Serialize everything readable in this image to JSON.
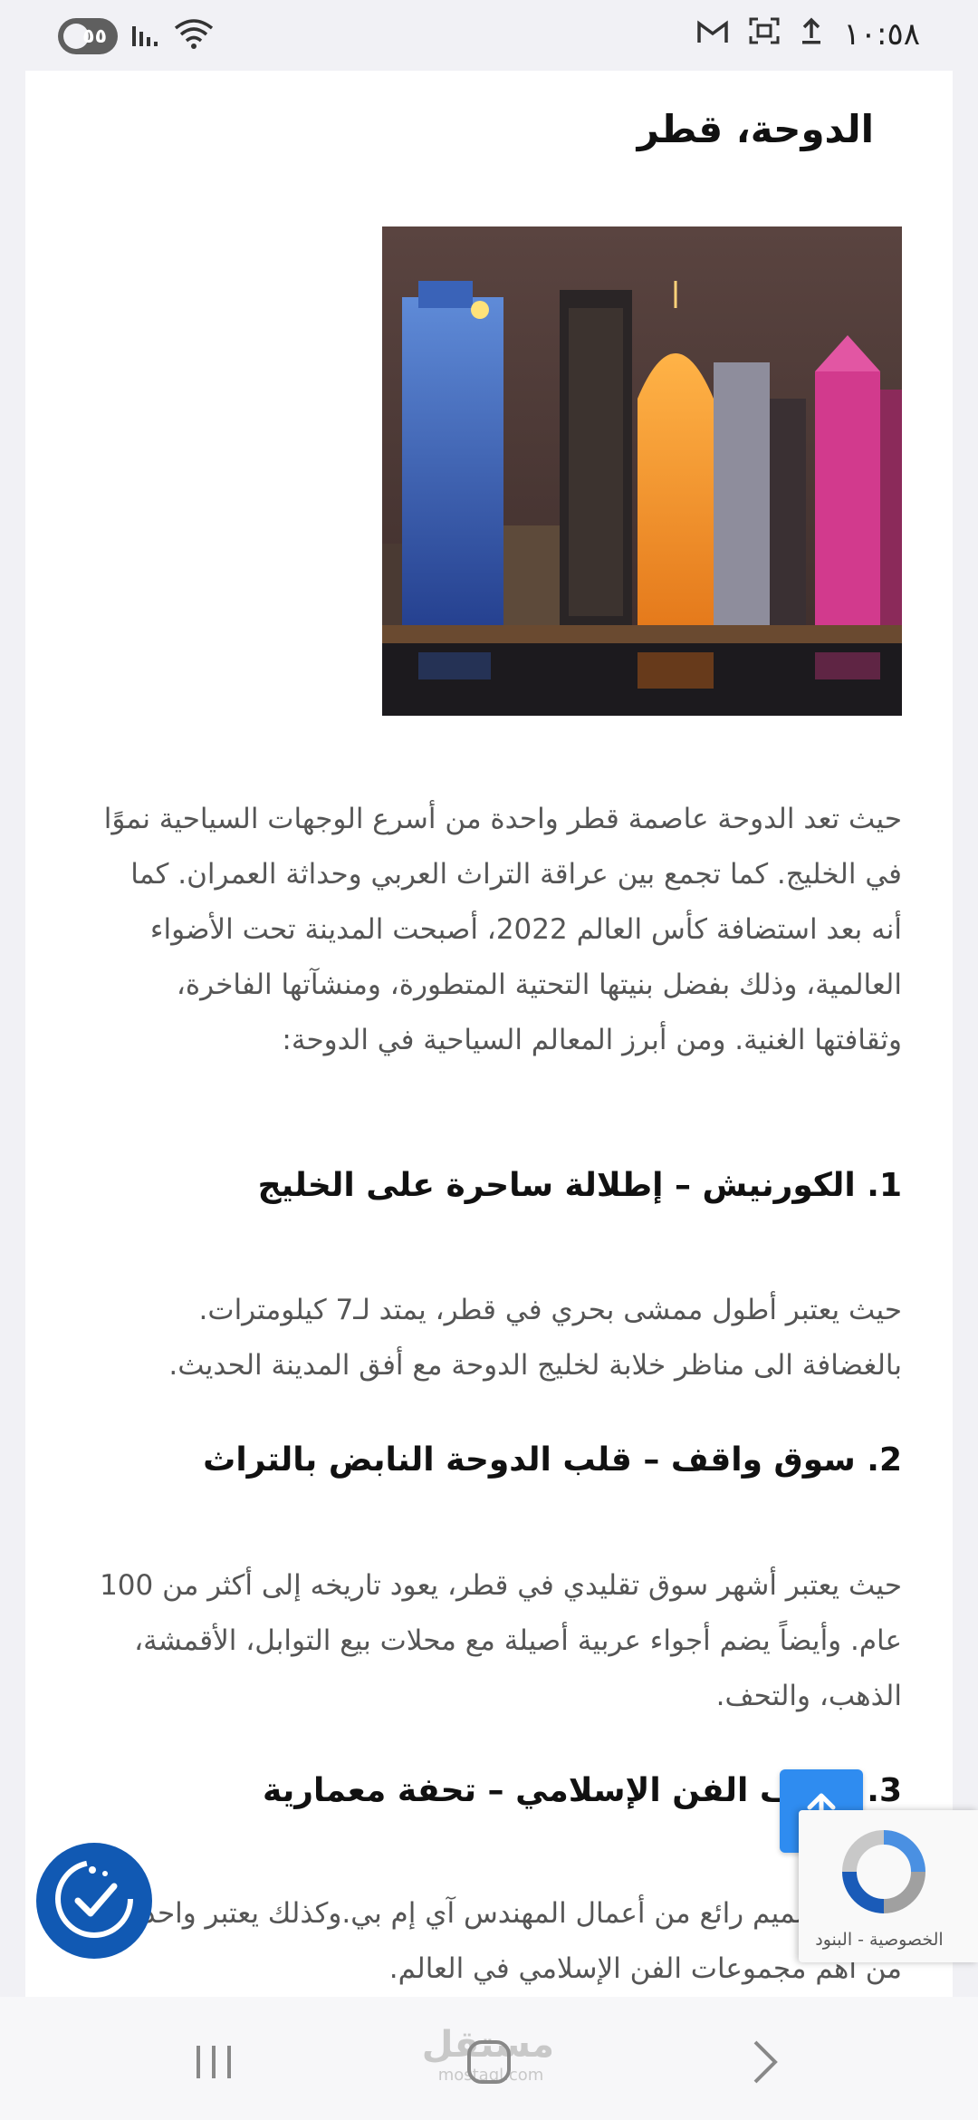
{
  "status_bar": {
    "time": "١٠:٥٨",
    "battery": "٥٥",
    "icons": [
      "upload-icon",
      "screenshot-icon",
      "gmail-icon",
      "wifi-icon",
      "signal-icon"
    ]
  },
  "article": {
    "title": "الدوحة، قطر",
    "image_alt": "Doha skyline at night",
    "intro": "حيث تعد الدوحة عاصمة قطر واحدة من أسرع الوجهات السياحية نموًا في الخليج. كما تجمع بين عراقة التراث العربي وحداثة العمران. كما أنه بعد استضافة كأس العالم 2022، أصبحت المدينة تحت الأضواء العالمية، وذلك بفضل بنيتها التحتية المتطورة، ومنشآتها الفاخرة، وثقافتها الغنية. ومن أبرز المعالم السياحية في الدوحة:",
    "sections": [
      {
        "heading": "1. الكورنيش – إطلالة ساحرة على الخليج",
        "body": "حيث يعتبر أطول ممشى بحري في قطر، يمتد لـ7 كيلومترات. بالغضافة الى مناظر خلابة لخليج الدوحة مع أفق المدينة الحديث."
      },
      {
        "heading": "2. سوق واقف – قلب الدوحة النابض بالتراث",
        "body": "حيث يعتبر أشهر سوق تقليدي في قطر، يعود تاريخه إلى أكثر من 100 عام. وأيضاً يضم أجواء عربية أصيلة مع محلات بيع التوابل، الأقمشة، الذهب، والتحف."
      },
      {
        "heading": "3. متحف الفن الإسلامي – تحفة معمارية",
        "body": "يتميز بتصميم رائع من أعمال المهندس آي إم بي.وكذلك يعتبر واحدة من أهم مجموعات الفن الإسلامي في العالم."
      }
    ]
  },
  "recaptcha": {
    "links": "الخصوصية - البنود"
  },
  "watermark": {
    "arabic": "مستقل",
    "latin": "mostaql.com"
  },
  "colors": {
    "accent": "#2f8cf0",
    "badge": "#1159b3",
    "text": "#555555"
  }
}
